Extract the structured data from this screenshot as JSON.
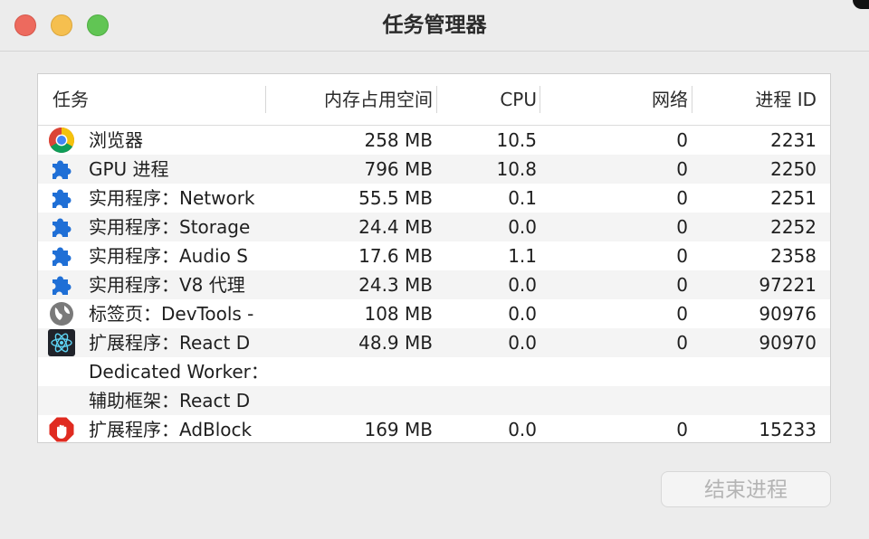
{
  "window": {
    "title": "任务管理器"
  },
  "table": {
    "columns": {
      "task": "任务",
      "memory": "内存占用空间",
      "cpu": "CPU",
      "network": "网络",
      "pid": "进程 ID"
    },
    "rows": [
      {
        "icon": "chrome-icon",
        "name": "浏览器",
        "memory": "258 MB",
        "cpu": "10.5",
        "network": "0",
        "pid": "2231"
      },
      {
        "icon": "puzzle-piece-icon",
        "name": "GPU 进程",
        "memory": "796 MB",
        "cpu": "10.8",
        "network": "0",
        "pid": "2250"
      },
      {
        "icon": "puzzle-piece-icon",
        "name": "实用程序：Network",
        "memory": "55.5 MB",
        "cpu": "0.1",
        "network": "0",
        "pid": "2251"
      },
      {
        "icon": "puzzle-piece-icon",
        "name": "实用程序：Storage",
        "memory": "24.4 MB",
        "cpu": "0.0",
        "network": "0",
        "pid": "2252"
      },
      {
        "icon": "puzzle-piece-icon",
        "name": "实用程序：Audio S",
        "memory": "17.6 MB",
        "cpu": "1.1",
        "network": "0",
        "pid": "2358"
      },
      {
        "icon": "puzzle-piece-icon",
        "name": "实用程序：V8 代理",
        "memory": "24.3 MB",
        "cpu": "0.0",
        "network": "0",
        "pid": "97221"
      },
      {
        "icon": "globe-icon",
        "name": "标签页：DevTools -",
        "memory": "108 MB",
        "cpu": "0.0",
        "network": "0",
        "pid": "90976"
      },
      {
        "icon": "react-icon",
        "name": "扩展程序：React D",
        "memory": "48.9 MB",
        "cpu": "0.0",
        "network": "0",
        "pid": "90970"
      },
      {
        "icon": "",
        "name": "Dedicated Worker：",
        "memory": "",
        "cpu": "",
        "network": "",
        "pid": ""
      },
      {
        "icon": "",
        "name": "辅助框架：React D",
        "memory": "",
        "cpu": "",
        "network": "",
        "pid": ""
      },
      {
        "icon": "adblock-icon",
        "name": "扩展程序：AdBlock",
        "memory": "169 MB",
        "cpu": "0.0",
        "network": "0",
        "pid": "15233"
      }
    ]
  },
  "buttons": {
    "end_process": "结束进程"
  },
  "colors": {
    "puzzle_blue": "#1f6fd6",
    "adblock_red": "#e02b20",
    "react_cyan": "#5ed3f3"
  }
}
